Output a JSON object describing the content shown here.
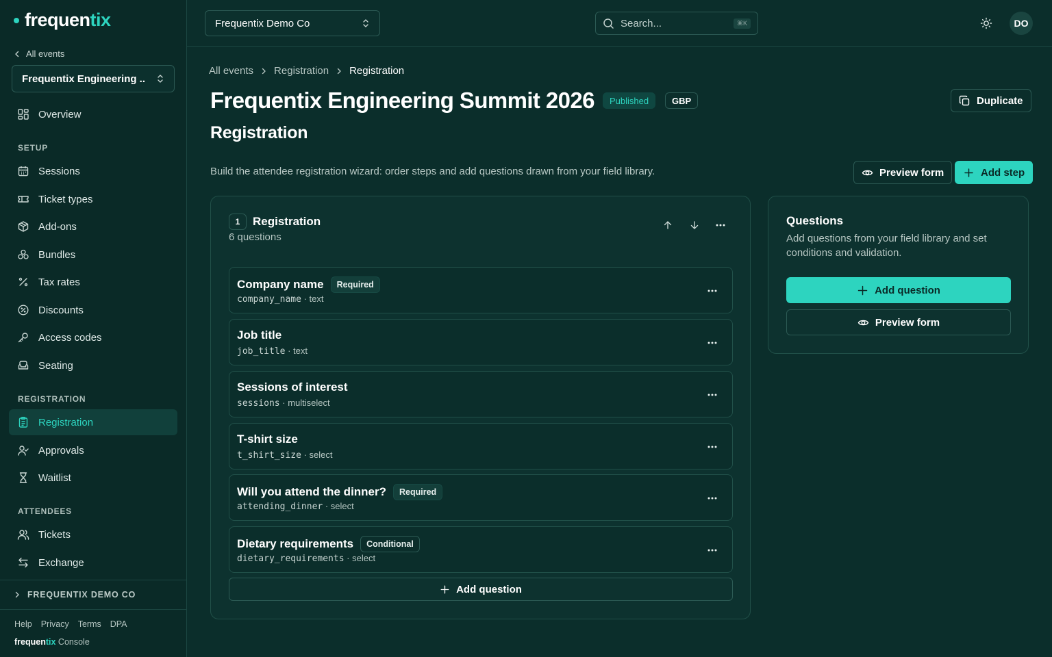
{
  "brand": {
    "name_main": "frequen",
    "name_accent": "tix"
  },
  "sidebar": {
    "back_label": "All events",
    "event_select": "Frequentix Engineering ...",
    "overview": "Overview",
    "sections": {
      "setup": "SETUP",
      "registration": "REGISTRATION",
      "attendees": "ATTENDEES"
    },
    "setup_items": [
      "Sessions",
      "Ticket types",
      "Add-ons",
      "Bundles",
      "Tax rates",
      "Discounts",
      "Access codes",
      "Seating"
    ],
    "registration_items": [
      "Registration",
      "Approvals",
      "Waitlist"
    ],
    "attendee_items": [
      "Tickets",
      "Exchange"
    ],
    "org_label": "FREQUENTIX DEMO CO",
    "footer_links": [
      "Help",
      "Privacy",
      "Terms",
      "DPA"
    ],
    "footer_brand_main": "frequen",
    "footer_brand_accent": "tix",
    "footer_brand_suffix": " Console"
  },
  "topbar": {
    "org_select": "Frequentix Demo Co",
    "search_placeholder": "Search...",
    "search_shortcut": "⌘K",
    "avatar_initials": "DO"
  },
  "breadcrumbs": [
    "All events",
    "Registration",
    "Registration"
  ],
  "page": {
    "title": "Frequentix Engineering Summit 2026",
    "status_badge": "Published",
    "currency_badge": "GBP",
    "duplicate_label": "Duplicate",
    "section_title": "Registration",
    "description": "Build the attendee registration wizard: order steps and add questions drawn from your field library.",
    "preview_form_label": "Preview form",
    "add_step_label": "Add step"
  },
  "step": {
    "number": "1",
    "name": "Registration",
    "question_count": "6 questions",
    "questions": [
      {
        "title": "Company name",
        "tag": "Required",
        "key": "company_name",
        "type": "· text"
      },
      {
        "title": "Job title",
        "tag": "",
        "key": "job_title",
        "type": "· text"
      },
      {
        "title": "Sessions of interest",
        "tag": "",
        "key": "sessions",
        "type": "· multiselect"
      },
      {
        "title": "T-shirt size",
        "tag": "",
        "key": "t_shirt_size",
        "type": "· select"
      },
      {
        "title": "Will you attend the dinner?",
        "tag": "Required",
        "key": "attending_dinner",
        "type": "· select"
      },
      {
        "title": "Dietary requirements",
        "tag": "Conditional",
        "key": "dietary_requirements",
        "type": "· select"
      }
    ],
    "add_question_label": "Add question"
  },
  "questions_panel": {
    "title": "Questions",
    "description": "Add questions from your field library and set conditions and validation.",
    "add_question_label": "Add question",
    "preview_form_label": "Preview form"
  },
  "colors": {
    "accent": "#2dd4bf",
    "background": "#0b2e2b",
    "sidebar": "#0a2a27"
  }
}
